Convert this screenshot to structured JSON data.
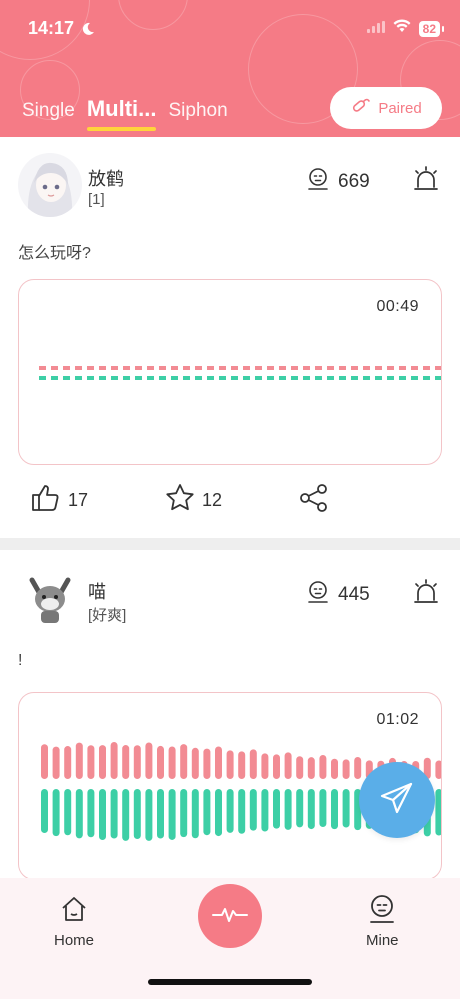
{
  "status": {
    "time": "14:17",
    "battery": "82"
  },
  "tabs": [
    {
      "label": "Single"
    },
    {
      "label": "Multi..."
    },
    {
      "label": "Siphon"
    }
  ],
  "active_tab_index": 1,
  "paired_label": "Paired",
  "posts": [
    {
      "name": "放鹤",
      "tag": "[1]",
      "listen_count": "669",
      "text": "怎么玩呀?",
      "duration": "00:49",
      "likes": "17",
      "stars": "12"
    },
    {
      "name": "喵",
      "tag": "[好爽]",
      "listen_count": "445",
      "text": "!",
      "duration": "01:02"
    }
  ],
  "nav": {
    "home": "Home",
    "mine": "Mine"
  },
  "colors": {
    "brand": "#f57b86",
    "accent_yellow": "#ffd43b",
    "wave_pink": "#f28b93",
    "wave_teal": "#3dcfa6",
    "fab_blue": "#5aaee8"
  }
}
